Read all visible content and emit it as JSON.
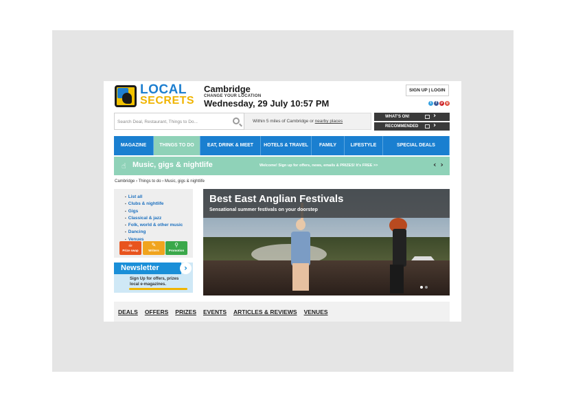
{
  "logo": {
    "line1": "LOCAL",
    "line2": "SECRETS"
  },
  "location": {
    "city": "Cambridge",
    "change_label": "CHANGE YOUR LOCATION",
    "datetime": "Wednesday, 29 July 10:57 PM"
  },
  "account": {
    "signup_login": "SIGN UP | LOGIN"
  },
  "socials": [
    {
      "icon": "twitter-icon",
      "glyph": "t",
      "color": "#3aa3e3"
    },
    {
      "icon": "facebook-icon",
      "glyph": "f",
      "color": "#3b5998"
    },
    {
      "icon": "pinterest-icon",
      "glyph": "p",
      "color": "#cb2027"
    },
    {
      "icon": "googleplus-icon",
      "glyph": "g",
      "color": "#dd4b39"
    }
  ],
  "search": {
    "placeholder": "Search Deal, Restaurant, Things to Do...",
    "value": ""
  },
  "radius": {
    "prefix": "Within 5 miles of Cambridge or ",
    "link": "nearby places"
  },
  "quicklinks": {
    "whats_on": "WHAT'S ON!",
    "recommended": "RECOMMENDED"
  },
  "nav": [
    {
      "label": "MAGAZINE",
      "active": false
    },
    {
      "label": "THINGS TO DO",
      "active": true
    },
    {
      "label": "EAT, DRINK & MEET",
      "active": false
    },
    {
      "label": "HOTELS & TRAVEL",
      "active": false
    },
    {
      "label": "FAMILY",
      "active": false
    },
    {
      "label": "LIFESTYLE",
      "active": false
    },
    {
      "label": "SPECIAL DEALS",
      "active": false
    }
  ],
  "section": {
    "title": "Music, gigs & nightlife",
    "welcome": "Welcome! Sign up for offers, news, emails & PRIZES! It's FREE >>",
    "arrows": "‹ ›"
  },
  "breadcrumb": "Cambridge › Things to do  › Music, gigs & nightlife",
  "categories": [
    "List all",
    "Clubs & nightlife",
    "Gigs",
    "Classical & jazz",
    "Folk, world & other music",
    "Dancing",
    "Venues"
  ],
  "tiles": [
    {
      "label": "Prize swap",
      "icon": "cup-icon",
      "glyph": "☕",
      "color": "#e8541e"
    },
    {
      "label": "Writers",
      "icon": "pen-icon",
      "glyph": "✎",
      "color": "#f0a41e"
    },
    {
      "label": "Promotion",
      "icon": "pin-icon",
      "glyph": "⚲",
      "color": "#3aa84a"
    }
  ],
  "newsletter": {
    "title": "Newsletter",
    "text_line1": "Sign Up for offers, prizes",
    "text_line2": "local e-magazines."
  },
  "hero": {
    "title": "Best East Anglian Festivals",
    "subtitle": "Sensational summer festivals on your doorstep"
  },
  "bottom_tabs": [
    "DEALS",
    "OFFERS",
    "PRIZES",
    "EVENTS",
    "ARTICLES & REVIEWS",
    "VENUES"
  ]
}
